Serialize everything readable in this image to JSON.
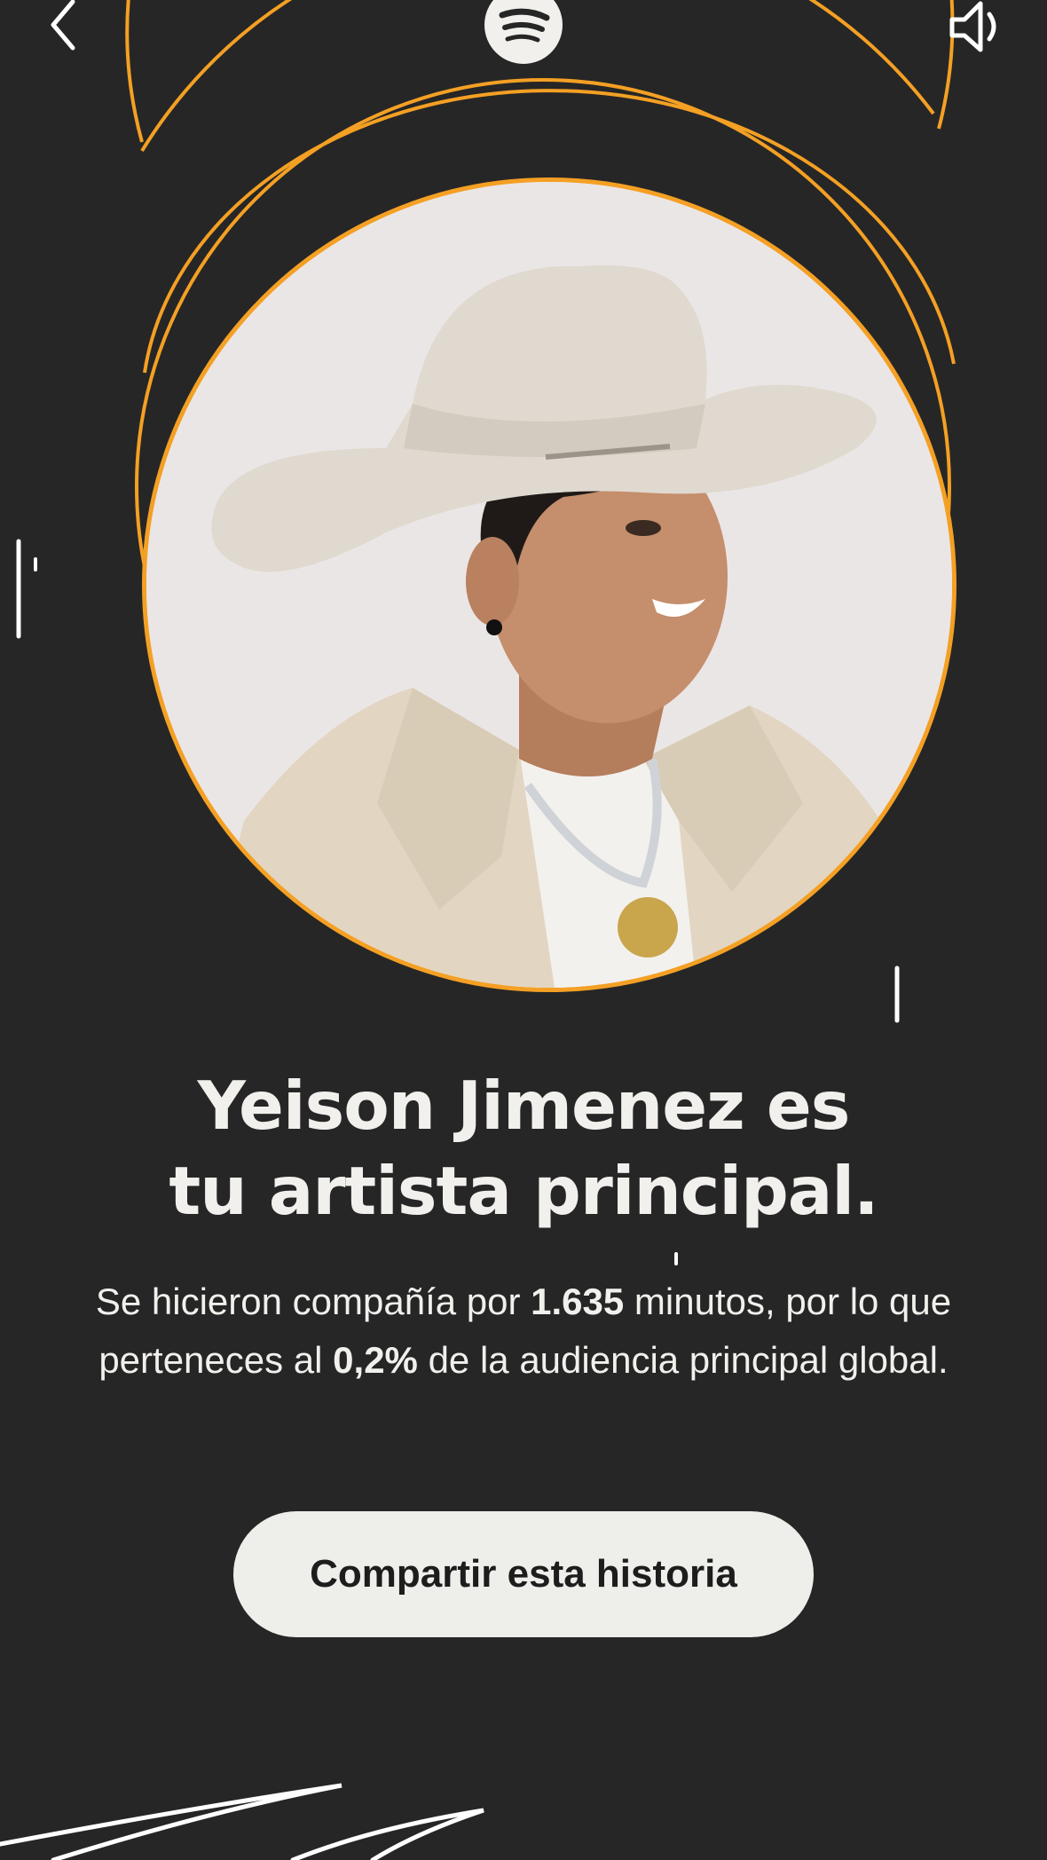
{
  "story": {
    "headline_line1": "Yeison Jimenez es",
    "headline_line2": "tu artista principal.",
    "body_part1": "Se hicieron compañía por ",
    "minutes": "1.635",
    "body_part2": " minutos, por lo que perteneces al ",
    "percent": "0,2%",
    "body_part3": " de la audiencia principal global.",
    "share_label": "Compartir esta historia"
  },
  "icons": {
    "back": "chevron-left-icon",
    "logo": "spotify-logo",
    "sound": "speaker-icon"
  },
  "colors": {
    "background": "#262626",
    "accent": "#f4a024",
    "text": "#f1f0ec",
    "button_bg": "#eeeeea",
    "button_text": "#1d1d1d"
  }
}
